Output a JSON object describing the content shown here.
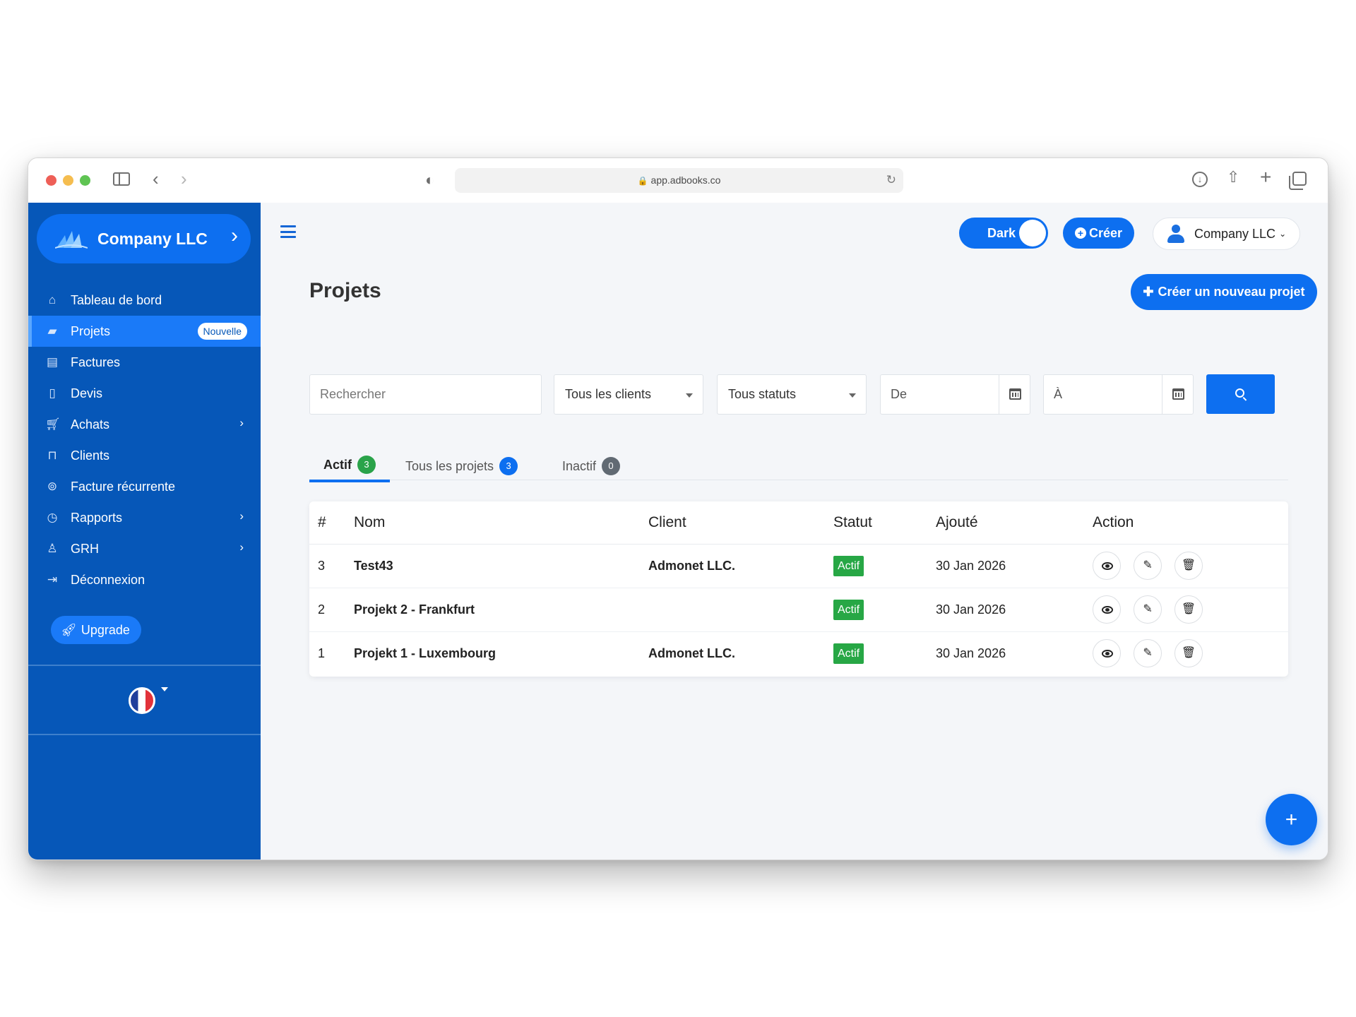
{
  "browser": {
    "url": "app.adbooks.co"
  },
  "sidebar": {
    "brand_name": "Company LLC",
    "items": [
      {
        "label": "Tableau de bord",
        "icon": "home-icon"
      },
      {
        "label": "Projets",
        "icon": "folder-open-icon",
        "badge": "Nouvelle"
      },
      {
        "label": "Factures",
        "icon": "invoice-icon"
      },
      {
        "label": "Devis",
        "icon": "document-icon"
      },
      {
        "label": "Achats",
        "icon": "cart-icon"
      },
      {
        "label": "Clients",
        "icon": "lock-icon"
      },
      {
        "label": "Facture récurrente",
        "icon": "recurring-icon"
      },
      {
        "label": "Rapports",
        "icon": "history-icon"
      },
      {
        "label": "GRH",
        "icon": "user-icon"
      },
      {
        "label": "Déconnexion",
        "icon": "logout-icon"
      }
    ],
    "upgrade_label": "Upgrade"
  },
  "header": {
    "dark_toggle_label": "Dark",
    "create_label": "Créer",
    "user_name": "Company LLC"
  },
  "page": {
    "title": "Projets",
    "new_project_label": "Créer un nouveau projet"
  },
  "filters": {
    "search_placeholder": "Rechercher",
    "clients_select": "Tous les clients",
    "status_select": "Tous statuts",
    "date_from": "De",
    "date_to": "À"
  },
  "tabs": [
    {
      "label": "Actif",
      "count": "3"
    },
    {
      "label": "Tous les projets",
      "count": "3"
    },
    {
      "label": "Inactif",
      "count": "0"
    }
  ],
  "table": {
    "headers": {
      "num": "#",
      "name": "Nom",
      "client": "Client",
      "status": "Statut",
      "added": "Ajouté",
      "action": "Action"
    },
    "rows": [
      {
        "num": "3",
        "name": "Test43",
        "client": "Admonet LLC.",
        "status": "Actif",
        "added": "30 Jan 2026"
      },
      {
        "num": "2",
        "name": "Projekt 2 - Frankfurt",
        "client": "",
        "status": "Actif",
        "added": "30 Jan 2026"
      },
      {
        "num": "1",
        "name": "Projekt 1 - Luxembourg",
        "client": "Admonet LLC.",
        "status": "Actif",
        "added": "30 Jan 2026"
      }
    ]
  },
  "colors": {
    "sidebar_bg": "#0657b8",
    "accent": "#0d6ff0",
    "status_active": "#27a745"
  }
}
